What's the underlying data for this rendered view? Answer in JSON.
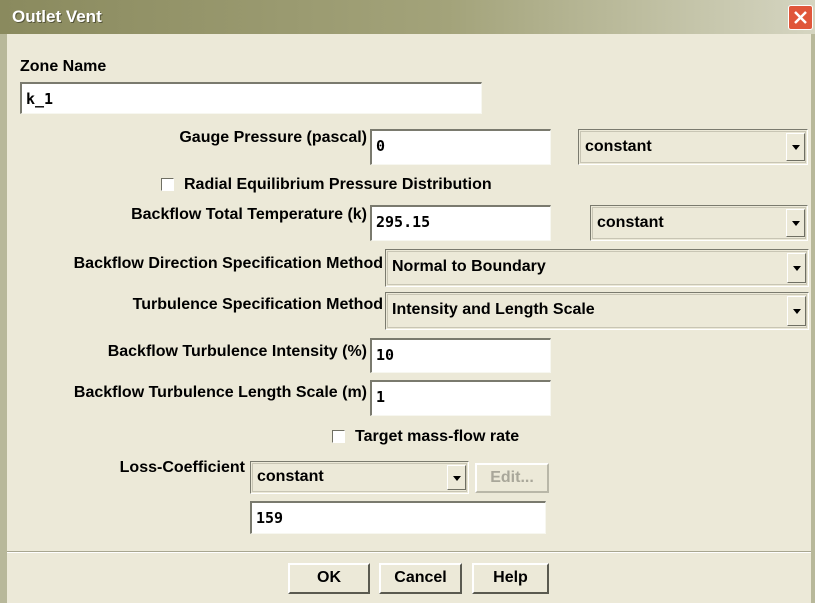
{
  "window": {
    "title": "Outlet Vent"
  },
  "zone": {
    "label": "Zone Name",
    "value": "k_1"
  },
  "gauge_pressure": {
    "label": "Gauge Pressure (pascal)",
    "value": "0",
    "profile": "constant"
  },
  "radial_equilibrium": {
    "label": "Radial Equilibrium Pressure Distribution",
    "checked": false
  },
  "backflow_temperature": {
    "label": "Backflow Total Temperature (k)",
    "value": "295.15",
    "profile": "constant"
  },
  "backflow_direction": {
    "label": "Backflow Direction Specification Method",
    "value": "Normal to Boundary"
  },
  "turbulence_method": {
    "label": "Turbulence Specification Method",
    "value": "Intensity and Length Scale"
  },
  "turbulence_intensity": {
    "label": "Backflow Turbulence Intensity (%)",
    "value": "10"
  },
  "turbulence_length": {
    "label": "Backflow Turbulence Length Scale (m)",
    "value": "1"
  },
  "target_mass_flow": {
    "label": "Target mass-flow rate",
    "checked": false
  },
  "loss_coefficient": {
    "label": "Loss-Coefficient",
    "profile": "constant",
    "edit_label": "Edit...",
    "value": "159"
  },
  "buttons": {
    "ok": "OK",
    "cancel": "Cancel",
    "help": "Help"
  },
  "colors": {
    "titlebar": "#a3a37a",
    "close": "#e0563a",
    "background": "#ece9d8"
  }
}
